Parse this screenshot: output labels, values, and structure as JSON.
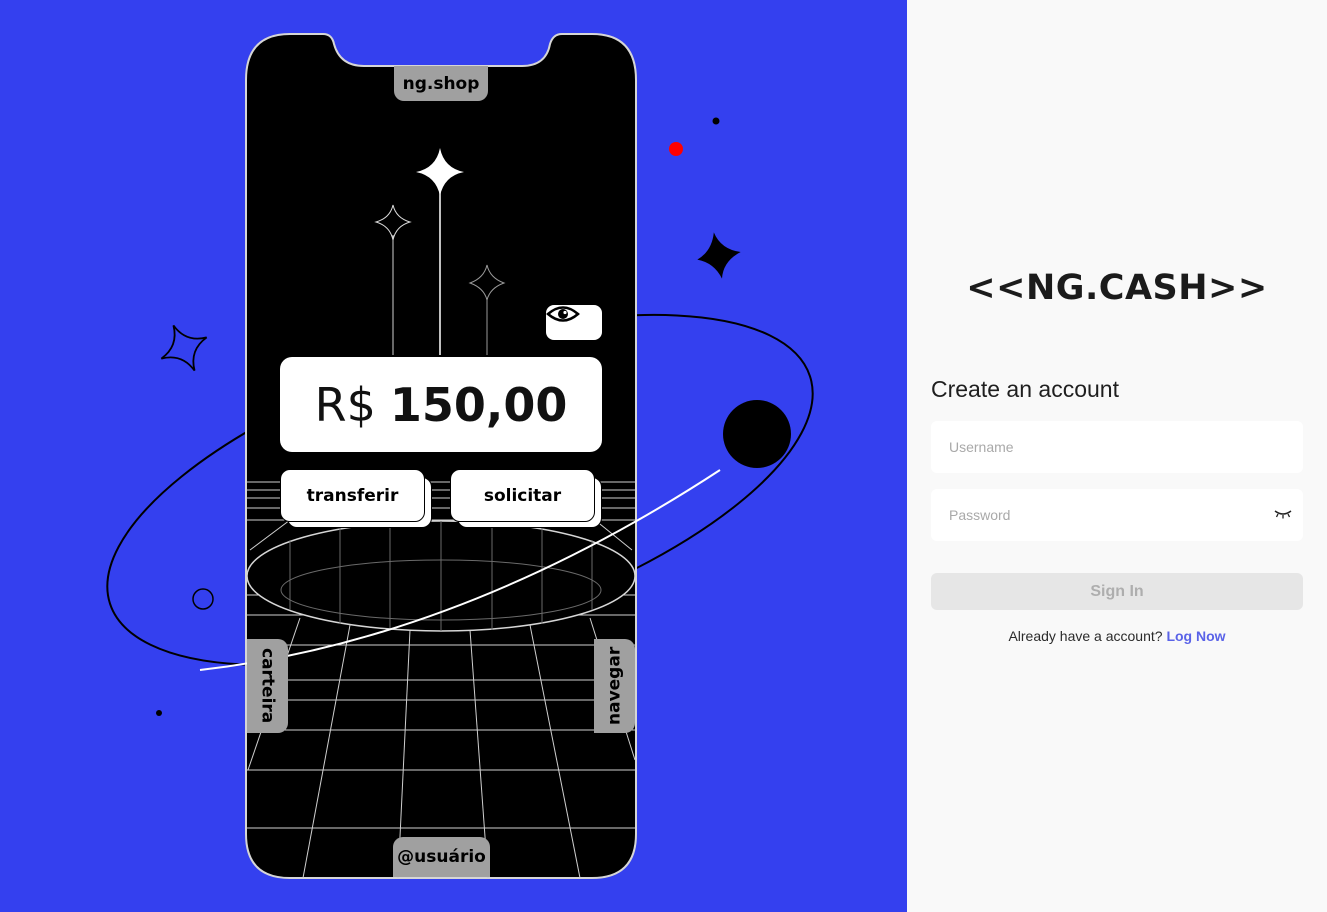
{
  "hero": {
    "phone": {
      "tab_top": "ng.shop",
      "tab_bottom": "@usuário",
      "tab_left": "carteira",
      "tab_right": "navegar",
      "balance_currency": "R$",
      "balance_amount": "150,00",
      "btn_transfer": "transferir",
      "btn_request": "solicitar"
    },
    "colors": {
      "background": "#3440ef",
      "accent_dot": "#ff0000"
    }
  },
  "panel": {
    "logo": "<<NG.CASH>>",
    "title": "Create an account",
    "username_placeholder": "Username",
    "password_placeholder": "Password",
    "password_toggle_icon": "eye-closed-icon",
    "signin_label": "Sign In",
    "switch_text": "Already have a account?",
    "switch_link": "Log Now",
    "colors": {
      "link": "#5a63e8",
      "button_disabled_bg": "#e6e6e6"
    }
  }
}
